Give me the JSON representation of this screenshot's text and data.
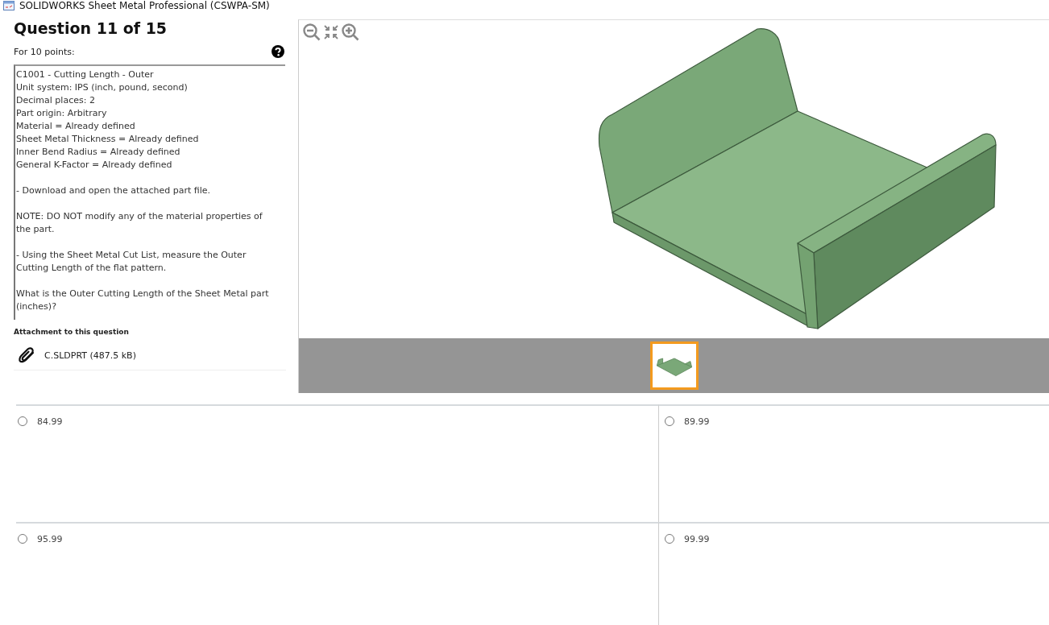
{
  "window": {
    "title": "SOLIDWORKS Sheet Metal Professional (CSWPA-SM)"
  },
  "question": {
    "heading": "Question 11 of 15",
    "points": "For 10 points:",
    "paragraphs": [
      {
        "lines": [
          "C1001 - Cutting Length - Outer",
          "Unit system: IPS (inch, pound, second)",
          "Decimal places: 2",
          "Part origin: Arbitrary",
          "Material = Already defined",
          "Sheet Metal Thickness = Already defined",
          "Inner Bend Radius = Already defined",
          "General K-Factor = Already defined"
        ]
      },
      {
        "lines": [
          "- Download and open the attached part file."
        ]
      },
      {
        "lines": [
          "NOTE: DO NOT modify any of the material properties of",
          "the part."
        ]
      },
      {
        "lines": [
          "- Using the Sheet Metal Cut List, measure the Outer",
          "Cutting Length of the flat pattern."
        ]
      },
      {
        "lines": [
          "What is the Outer Cutting Length of the Sheet Metal part",
          "(inches)?"
        ]
      }
    ]
  },
  "attachment": {
    "heading": "Attachment to this question",
    "file": "C.SLDPRT (487.5 kB)"
  },
  "viewer": {
    "thumbnails": [
      {
        "selected": true
      }
    ]
  },
  "answers": [
    {
      "label": "84.99",
      "selected": false
    },
    {
      "label": "89.99",
      "selected": false
    },
    {
      "label": "95.99",
      "selected": false
    },
    {
      "label": "99.99",
      "selected": false
    }
  ]
}
